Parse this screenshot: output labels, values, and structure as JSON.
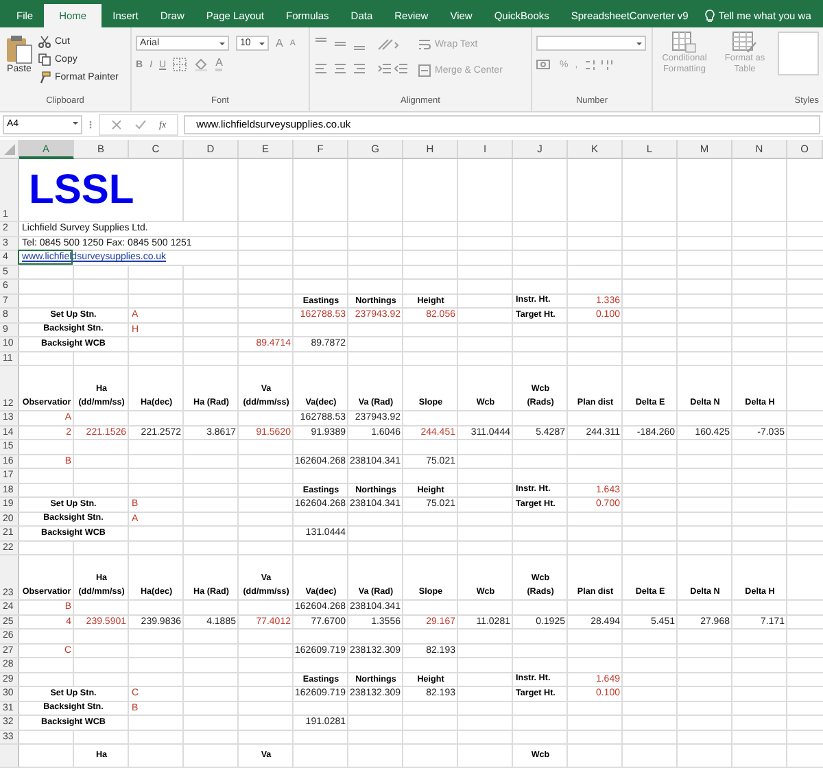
{
  "tabs": [
    {
      "label": "File",
      "selected": false
    },
    {
      "label": "Home",
      "selected": true
    },
    {
      "label": "Insert",
      "selected": false
    },
    {
      "label": "Draw",
      "selected": false
    },
    {
      "label": "Page Layout",
      "selected": false
    },
    {
      "label": "Formulas",
      "selected": false
    },
    {
      "label": "Data",
      "selected": false
    },
    {
      "label": "Review",
      "selected": false
    },
    {
      "label": "View",
      "selected": false
    },
    {
      "label": "QuickBooks",
      "selected": false
    },
    {
      "label": "SpreadsheetConverter v9",
      "selected": false
    }
  ],
  "tell_me": "Tell me what you wa",
  "clipboard": {
    "group": "Clipboard",
    "paste": "Paste",
    "commands": [
      {
        "label": "Cut",
        "kind": "cut",
        "disabled": false
      },
      {
        "label": "Copy",
        "kind": "copy",
        "disabled": false
      },
      {
        "label": "Format Painter",
        "kind": "painter",
        "disabled": false
      }
    ]
  },
  "font": {
    "group": "Font",
    "family": "Arial",
    "size": "10",
    "grow": "A",
    "shrink": "A",
    "bold": "B",
    "italic": "I",
    "underline": "U",
    "text_color": "A"
  },
  "alignment": {
    "group": "Alignment",
    "wrap": {
      "label": "Wrap Text",
      "disabled": true
    },
    "merge": {
      "label": "Merge & Center",
      "disabled": true
    }
  },
  "number": {
    "group": "Number",
    "percent": "%",
    "comma": ","
  },
  "styles": {
    "group": "Styles",
    "commands": [
      {
        "label": "Conditional Formatting",
        "kind": "conditional",
        "disabled": true
      },
      {
        "label": "Format as Table",
        "kind": "table",
        "disabled": true
      }
    ]
  },
  "formula_bar": {
    "name_box": "A4",
    "fx": "fx",
    "value": "www.lichfieldsurveysupplies.co.uk"
  },
  "sheet": {
    "columns": [
      {
        "label": "A",
        "selected": true
      },
      {
        "label": "B",
        "selected": false
      },
      {
        "label": "C",
        "selected": false
      },
      {
        "label": "D",
        "selected": false
      },
      {
        "label": "E",
        "selected": false
      },
      {
        "label": "F",
        "selected": false
      },
      {
        "label": "G",
        "selected": false
      },
      {
        "label": "H",
        "selected": false
      },
      {
        "label": "I",
        "selected": false
      },
      {
        "label": "J",
        "selected": false
      },
      {
        "label": "K",
        "selected": false
      },
      {
        "label": "L",
        "selected": false
      },
      {
        "label": "M",
        "selected": false
      },
      {
        "label": "N",
        "selected": false
      },
      {
        "label": "O",
        "selected": false
      }
    ],
    "rows": [
      {
        "number": "1",
        "kind": "logo",
        "cells": {
          "A": {
            "kind": "logo",
            "text": "LSSL"
          }
        }
      },
      {
        "number": "2",
        "cells": {
          "A": {
            "kind": "text",
            "text": "Lichfield Survey Supplies Ltd."
          }
        }
      },
      {
        "number": "3",
        "cells": {
          "A": {
            "kind": "text",
            "text": "Tel: 0845 500 1250  Fax: 0845 500 1251"
          }
        }
      },
      {
        "number": "4",
        "cells": {
          "A": {
            "kind": "link",
            "text": "www.lichfieldsurveysupplies.co.uk",
            "selected": true
          }
        }
      },
      {
        "number": "5"
      },
      {
        "number": "6"
      },
      {
        "number": "7",
        "cells": {
          "F": {
            "kind": "head",
            "text": "Eastings"
          },
          "G": {
            "kind": "head",
            "text": "Northings"
          },
          "H": {
            "kind": "head",
            "text": "Height"
          },
          "J": {
            "kind": "head-left",
            "text": "Instr. Ht."
          },
          "K": {
            "kind": "input",
            "text": "1.336"
          }
        }
      },
      {
        "number": "8",
        "cells": {
          "A": {
            "kind": "label",
            "text": "Set Up Stn."
          },
          "C": {
            "kind": "input-left",
            "text": "A"
          },
          "F": {
            "kind": "input",
            "text": "162788.53"
          },
          "G": {
            "kind": "input",
            "text": "237943.92"
          },
          "H": {
            "kind": "input",
            "text": "82.056"
          },
          "J": {
            "kind": "head-left",
            "text": "Target Ht."
          },
          "K": {
            "kind": "input",
            "text": "0.100"
          }
        }
      },
      {
        "number": "9",
        "cells": {
          "A": {
            "kind": "label",
            "text": "Backsight Stn."
          },
          "C": {
            "kind": "input-left",
            "text": "H"
          }
        }
      },
      {
        "number": "10",
        "cells": {
          "A": {
            "kind": "label",
            "text": "Backsight WCB"
          },
          "E": {
            "kind": "input",
            "text": "89.4714"
          },
          "F": {
            "kind": "value",
            "text": "89.7872"
          }
        }
      },
      {
        "number": "11"
      },
      {
        "number": "12",
        "kind": "tall",
        "cells": {
          "A": {
            "kind": "head",
            "text": "Observatior"
          },
          "B": {
            "kind": "head",
            "text": "Ha\n(dd/mm/ss)"
          },
          "C": {
            "kind": "head",
            "text": "Ha(dec)"
          },
          "D": {
            "kind": "head",
            "text": "Ha (Rad)"
          },
          "E": {
            "kind": "head",
            "text": "Va\n(dd/mm/ss)"
          },
          "F": {
            "kind": "head",
            "text": "Va(dec)"
          },
          "G": {
            "kind": "head",
            "text": "Va (Rad)"
          },
          "H": {
            "kind": "head",
            "text": "Slope"
          },
          "I": {
            "kind": "head",
            "text": "Wcb"
          },
          "J": {
            "kind": "head",
            "text": "Wcb\n(Rads)"
          },
          "K": {
            "kind": "head",
            "text": "Plan dist"
          },
          "L": {
            "kind": "head",
            "text": "Delta E"
          },
          "M": {
            "kind": "head",
            "text": "Delta N"
          },
          "N": {
            "kind": "head",
            "text": "Delta H"
          }
        }
      },
      {
        "number": "13",
        "cells": {
          "A": {
            "kind": "input",
            "text": "A"
          },
          "F": {
            "kind": "value",
            "text": "162788.53"
          },
          "G": {
            "kind": "value",
            "text": "237943.92"
          }
        }
      },
      {
        "number": "14",
        "cells": {
          "A": {
            "kind": "input",
            "text": "2"
          },
          "B": {
            "kind": "input",
            "text": "221.1526"
          },
          "C": {
            "kind": "value",
            "text": "221.2572"
          },
          "D": {
            "kind": "value",
            "text": "3.8617"
          },
          "E": {
            "kind": "input",
            "text": "91.5620"
          },
          "F": {
            "kind": "value",
            "text": "91.9389"
          },
          "G": {
            "kind": "value",
            "text": "1.6046"
          },
          "H": {
            "kind": "input",
            "text": "244.451"
          },
          "I": {
            "kind": "value",
            "text": "311.0444"
          },
          "J": {
            "kind": "value",
            "text": "5.4287"
          },
          "K": {
            "kind": "value",
            "text": "244.311"
          },
          "L": {
            "kind": "value",
            "text": "-184.260"
          },
          "M": {
            "kind": "value",
            "text": "160.425"
          },
          "N": {
            "kind": "value",
            "text": "-7.035"
          }
        }
      },
      {
        "number": "15"
      },
      {
        "number": "16",
        "cells": {
          "A": {
            "kind": "input",
            "text": "B"
          },
          "F": {
            "kind": "value",
            "text": "162604.268"
          },
          "G": {
            "kind": "value",
            "text": "238104.341"
          },
          "H": {
            "kind": "value",
            "text": "75.021"
          }
        }
      },
      {
        "number": "17"
      },
      {
        "number": "18",
        "cells": {
          "F": {
            "kind": "head",
            "text": "Eastings"
          },
          "G": {
            "kind": "head",
            "text": "Northings"
          },
          "H": {
            "kind": "head",
            "text": "Height"
          },
          "J": {
            "kind": "head-left",
            "text": "Instr. Ht."
          },
          "K": {
            "kind": "input",
            "text": "1.643"
          }
        }
      },
      {
        "number": "19",
        "cells": {
          "A": {
            "kind": "label",
            "text": "Set Up Stn."
          },
          "C": {
            "kind": "input-left",
            "text": "B"
          },
          "F": {
            "kind": "value",
            "text": "162604.268"
          },
          "G": {
            "kind": "value",
            "text": "238104.341"
          },
          "H": {
            "kind": "value",
            "text": "75.021"
          },
          "J": {
            "kind": "head-left",
            "text": "Target Ht."
          },
          "K": {
            "kind": "input",
            "text": "0.700"
          }
        }
      },
      {
        "number": "20",
        "cells": {
          "A": {
            "kind": "label",
            "text": "Backsight Stn."
          },
          "C": {
            "kind": "input-left",
            "text": "A"
          }
        }
      },
      {
        "number": "21",
        "cells": {
          "A": {
            "kind": "label",
            "text": "Backsight WCB"
          },
          "F": {
            "kind": "value",
            "text": "131.0444"
          }
        }
      },
      {
        "number": "22"
      },
      {
        "number": "23",
        "kind": "tall",
        "cells": {
          "A": {
            "kind": "head",
            "text": "Observatior"
          },
          "B": {
            "kind": "head",
            "text": "Ha\n(dd/mm/ss)"
          },
          "C": {
            "kind": "head",
            "text": "Ha(dec)"
          },
          "D": {
            "kind": "head",
            "text": "Ha (Rad)"
          },
          "E": {
            "kind": "head",
            "text": "Va\n(dd/mm/ss)"
          },
          "F": {
            "kind": "head",
            "text": "Va(dec)"
          },
          "G": {
            "kind": "head",
            "text": "Va (Rad)"
          },
          "H": {
            "kind": "head",
            "text": "Slope"
          },
          "I": {
            "kind": "head",
            "text": "Wcb"
          },
          "J": {
            "kind": "head",
            "text": "Wcb\n(Rads)"
          },
          "K": {
            "kind": "head",
            "text": "Plan dist"
          },
          "L": {
            "kind": "head",
            "text": "Delta E"
          },
          "M": {
            "kind": "head",
            "text": "Delta N"
          },
          "N": {
            "kind": "head",
            "text": "Delta H"
          }
        }
      },
      {
        "number": "24",
        "cells": {
          "A": {
            "kind": "input",
            "text": "B"
          },
          "F": {
            "kind": "value",
            "text": "162604.268"
          },
          "G": {
            "kind": "value",
            "text": "238104.341"
          }
        }
      },
      {
        "number": "25",
        "cells": {
          "A": {
            "kind": "input",
            "text": "4"
          },
          "B": {
            "kind": "input",
            "text": "239.5901"
          },
          "C": {
            "kind": "value",
            "text": "239.9836"
          },
          "D": {
            "kind": "value",
            "text": "4.1885"
          },
          "E": {
            "kind": "input",
            "text": "77.4012"
          },
          "F": {
            "kind": "value",
            "text": "77.6700"
          },
          "G": {
            "kind": "value",
            "text": "1.3556"
          },
          "H": {
            "kind": "input",
            "text": "29.167"
          },
          "I": {
            "kind": "value",
            "text": "11.0281"
          },
          "J": {
            "kind": "value",
            "text": "0.1925"
          },
          "K": {
            "kind": "value",
            "text": "28.494"
          },
          "L": {
            "kind": "value",
            "text": "5.451"
          },
          "M": {
            "kind": "value",
            "text": "27.968"
          },
          "N": {
            "kind": "value",
            "text": "7.171"
          }
        }
      },
      {
        "number": "26"
      },
      {
        "number": "27",
        "cells": {
          "A": {
            "kind": "input",
            "text": "C"
          },
          "F": {
            "kind": "value",
            "text": "162609.719"
          },
          "G": {
            "kind": "value",
            "text": "238132.309"
          },
          "H": {
            "kind": "value",
            "text": "82.193"
          }
        }
      },
      {
        "number": "28"
      },
      {
        "number": "29",
        "cells": {
          "F": {
            "kind": "head",
            "text": "Eastings"
          },
          "G": {
            "kind": "head",
            "text": "Northings"
          },
          "H": {
            "kind": "head",
            "text": "Height"
          },
          "J": {
            "kind": "head-left",
            "text": "Instr. Ht."
          },
          "K": {
            "kind": "input",
            "text": "1.649"
          }
        }
      },
      {
        "number": "30",
        "cells": {
          "A": {
            "kind": "label",
            "text": "Set Up Stn."
          },
          "C": {
            "kind": "input-left",
            "text": "C"
          },
          "F": {
            "kind": "value",
            "text": "162609.719"
          },
          "G": {
            "kind": "value",
            "text": "238132.309"
          },
          "H": {
            "kind": "value",
            "text": "82.193"
          },
          "J": {
            "kind": "head-left",
            "text": "Target Ht."
          },
          "K": {
            "kind": "input",
            "text": "0.100"
          }
        }
      },
      {
        "number": "31",
        "cells": {
          "A": {
            "kind": "label",
            "text": "Backsight Stn."
          },
          "C": {
            "kind": "input-left",
            "text": "B"
          }
        }
      },
      {
        "number": "32",
        "cells": {
          "A": {
            "kind": "label",
            "text": "Backsight WCB"
          },
          "F": {
            "kind": "value",
            "text": "191.0281"
          }
        }
      },
      {
        "number": "33"
      },
      {
        "kind": "partial",
        "cells": {
          "B": {
            "kind": "head",
            "text": "Ha"
          },
          "E": {
            "kind": "head",
            "text": "Va"
          },
          "J": {
            "kind": "head",
            "text": "Wcb"
          }
        }
      }
    ]
  }
}
